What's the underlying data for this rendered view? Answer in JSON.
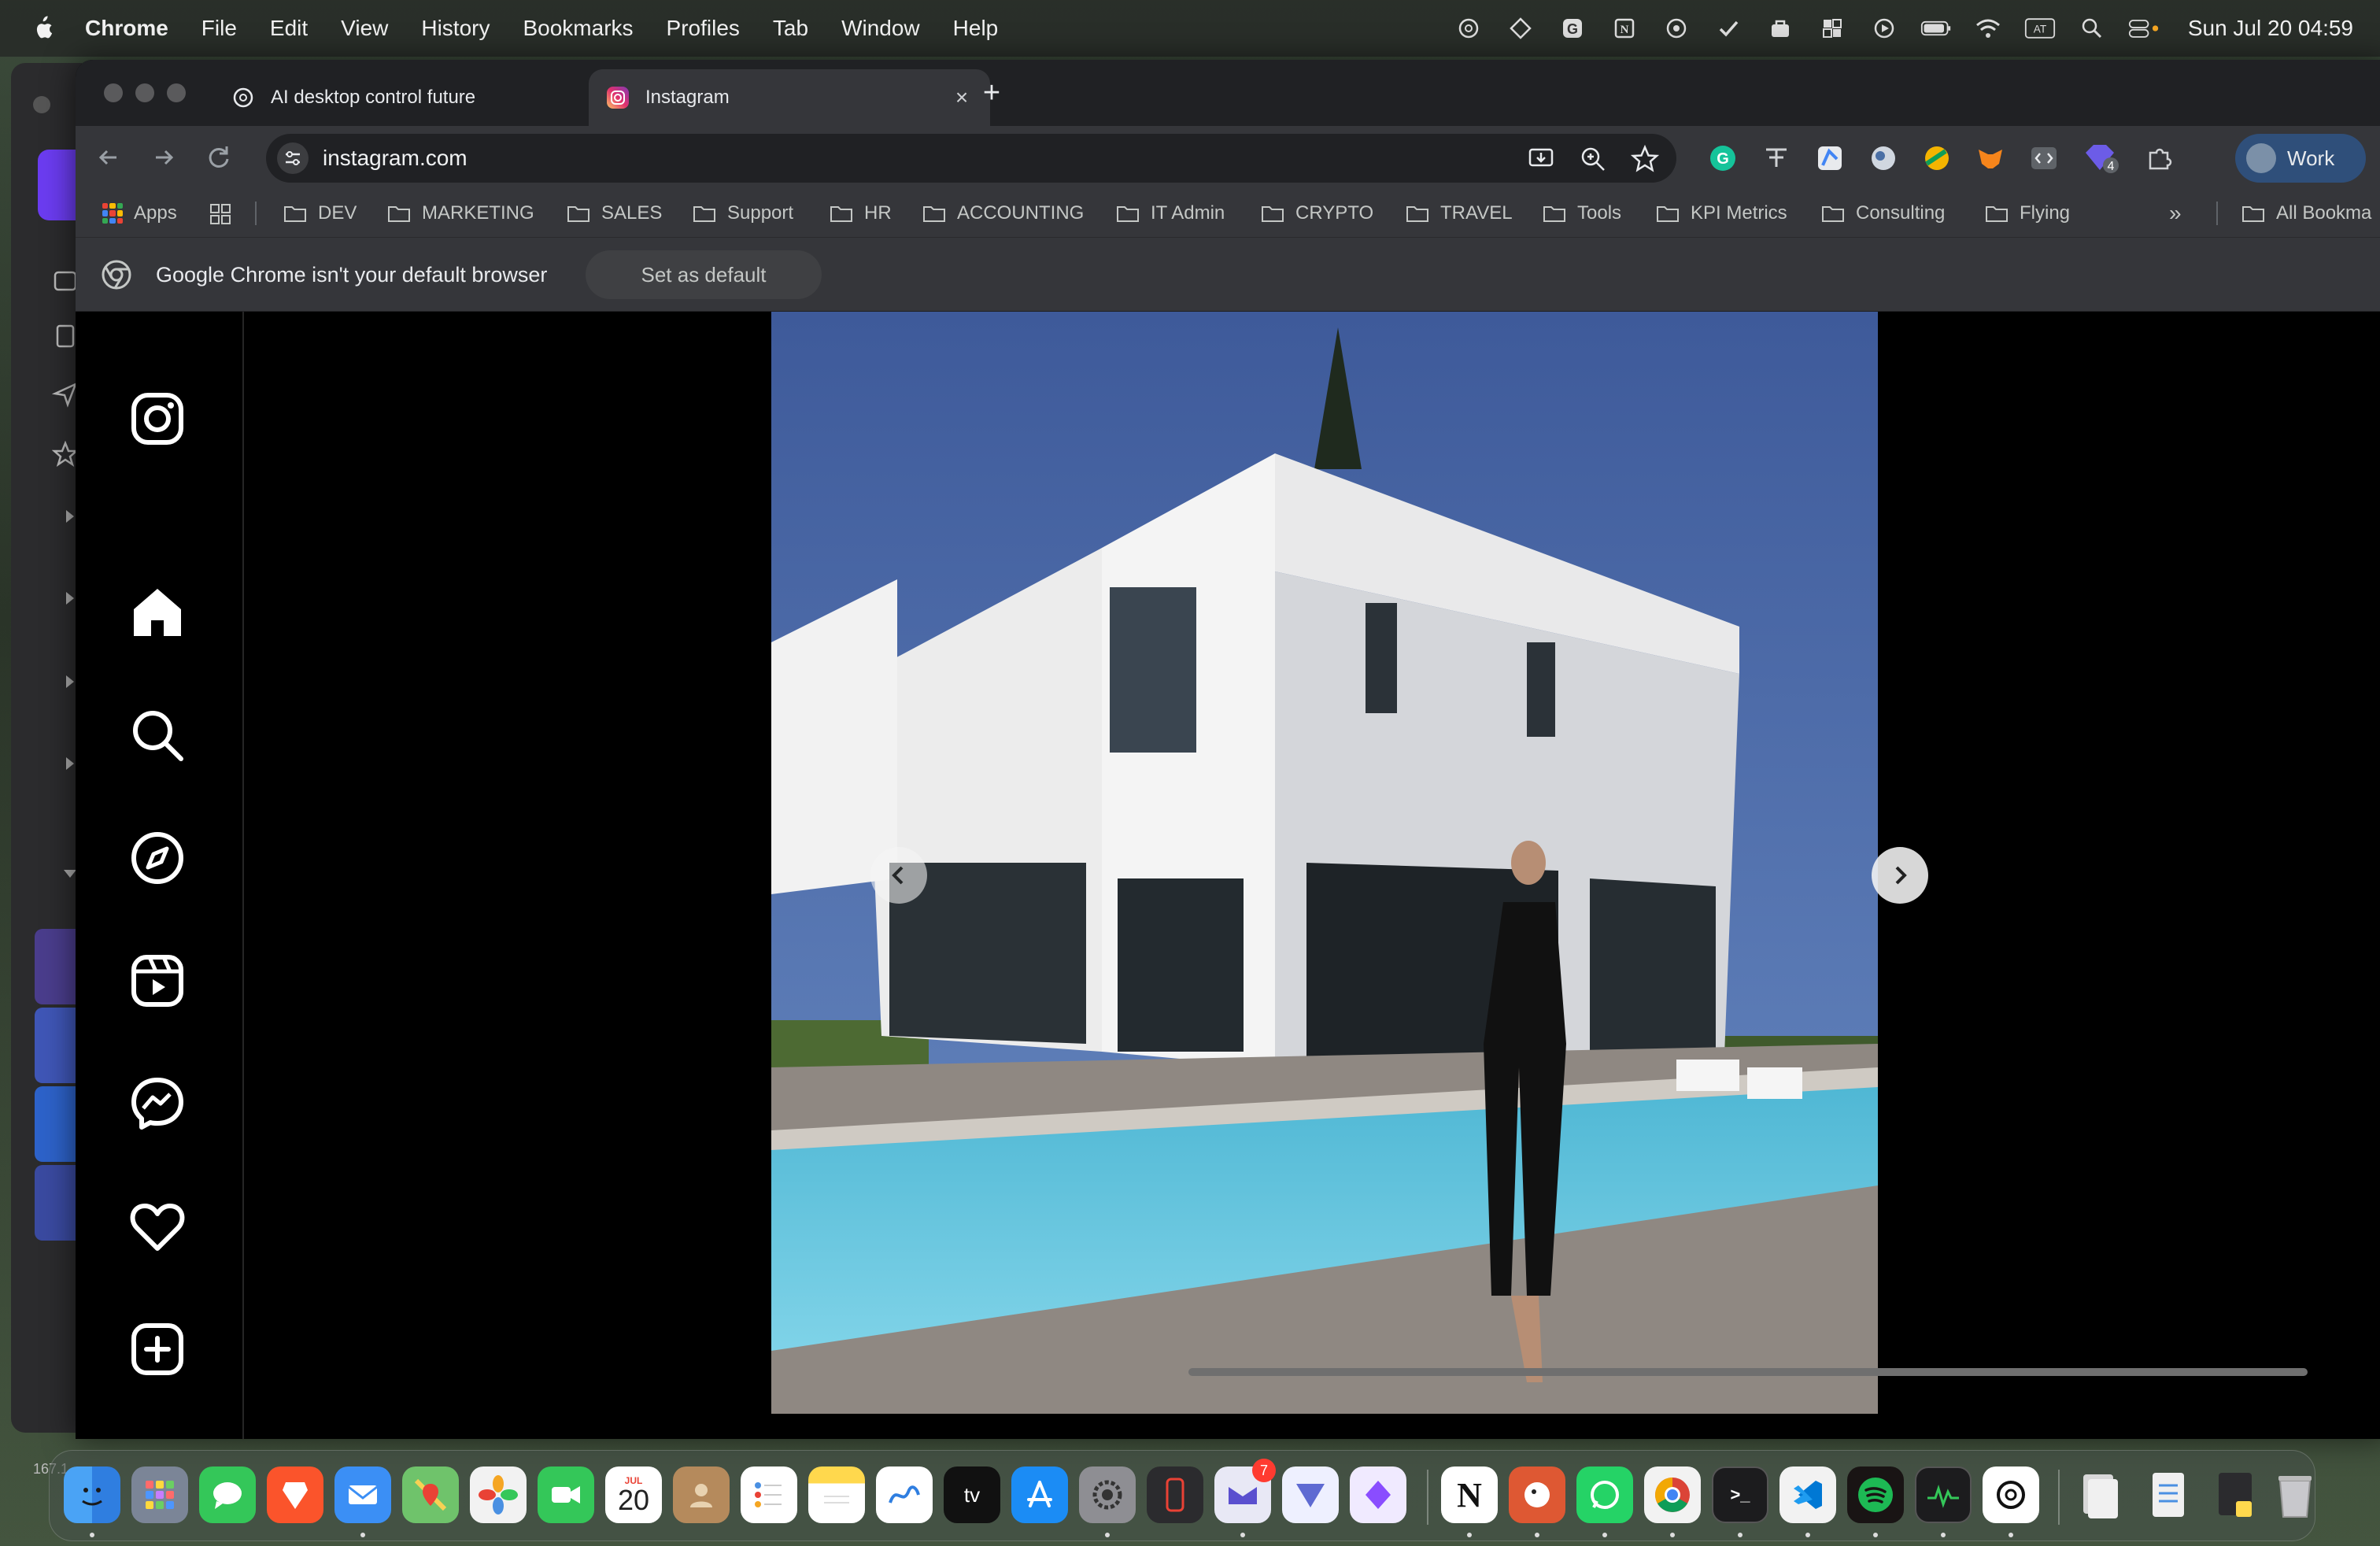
{
  "menubar": {
    "app_name": "Chrome",
    "items": [
      "File",
      "Edit",
      "View",
      "History",
      "Bookmarks",
      "Profiles",
      "Tab",
      "Window",
      "Help"
    ],
    "clock": "Sun Jul 20  04:59",
    "status_icons": [
      "chatgpt-icon",
      "perplexity-icon",
      "grammarly-icon",
      "notion-icon",
      "at-sign-icon",
      "check-icon",
      "bag-icon",
      "grid-icon",
      "play-icon",
      "battery-icon",
      "wifi-icon",
      "keyboard-input-icon",
      "search-icon",
      "control-center-icon"
    ],
    "keyboard_label": "AT"
  },
  "background_app": {
    "number_label": "167.1"
  },
  "browser": {
    "tabs": [
      {
        "title": "AI desktop control future",
        "icon": "chatgpt-icon",
        "active": false
      },
      {
        "title": "Instagram",
        "icon": "instagram-icon",
        "active": true
      }
    ],
    "url": "instagram.com",
    "profile_label": "Work",
    "extension_badge": "4",
    "bookmarks": [
      {
        "label": "Apps",
        "icon": "apps-grid-icon"
      },
      {
        "label": "DEV"
      },
      {
        "label": "MARKETING"
      },
      {
        "label": "SALES"
      },
      {
        "label": "Support"
      },
      {
        "label": "HR"
      },
      {
        "label": "ACCOUNTING"
      },
      {
        "label": "IT Admin"
      },
      {
        "label": "CRYPTO"
      },
      {
        "label": "TRAVEL"
      },
      {
        "label": "Tools"
      },
      {
        "label": "KPI Metrics"
      },
      {
        "label": "Consulting"
      },
      {
        "label": "Flying"
      }
    ],
    "bookmarks_overflow": "»",
    "all_bookmarks": "All Bookma",
    "infobar": {
      "message": "Google Chrome isn't your default browser",
      "button": "Set as default"
    }
  },
  "instagram": {
    "nav": [
      "instagram-logo-icon",
      "home-icon",
      "search-icon",
      "explore-icon",
      "reels-icon",
      "messenger-icon",
      "heart-icon",
      "create-icon"
    ],
    "post": {
      "carousel_prev": "‹",
      "carousel_next": "›"
    }
  },
  "dock": {
    "apps": [
      "Finder",
      "Launchpad",
      "Messages",
      "Brave",
      "Mail",
      "Maps",
      "Photos",
      "FaceTime",
      "Calendar",
      "Contacts",
      "Reminders",
      "Notes",
      "Freeform",
      "TV",
      "App Store",
      "System Settings",
      "iPhone Mirroring",
      "Spark Mail",
      "Linear",
      "Perplexity",
      "Notion",
      "DuckDuckGo",
      "WhatsApp",
      "Chrome",
      "Terminal",
      "VS Code",
      "Spotify",
      "Activity Monitor",
      "ChatGPT",
      "Downloads",
      "Documents",
      "Recent",
      "Trash"
    ],
    "calendar_month": "JUL",
    "calendar_day": "20",
    "tv_label": "tv",
    "mail_badge": "7",
    "notion_letter": "N",
    "terminal_label": ">_"
  }
}
